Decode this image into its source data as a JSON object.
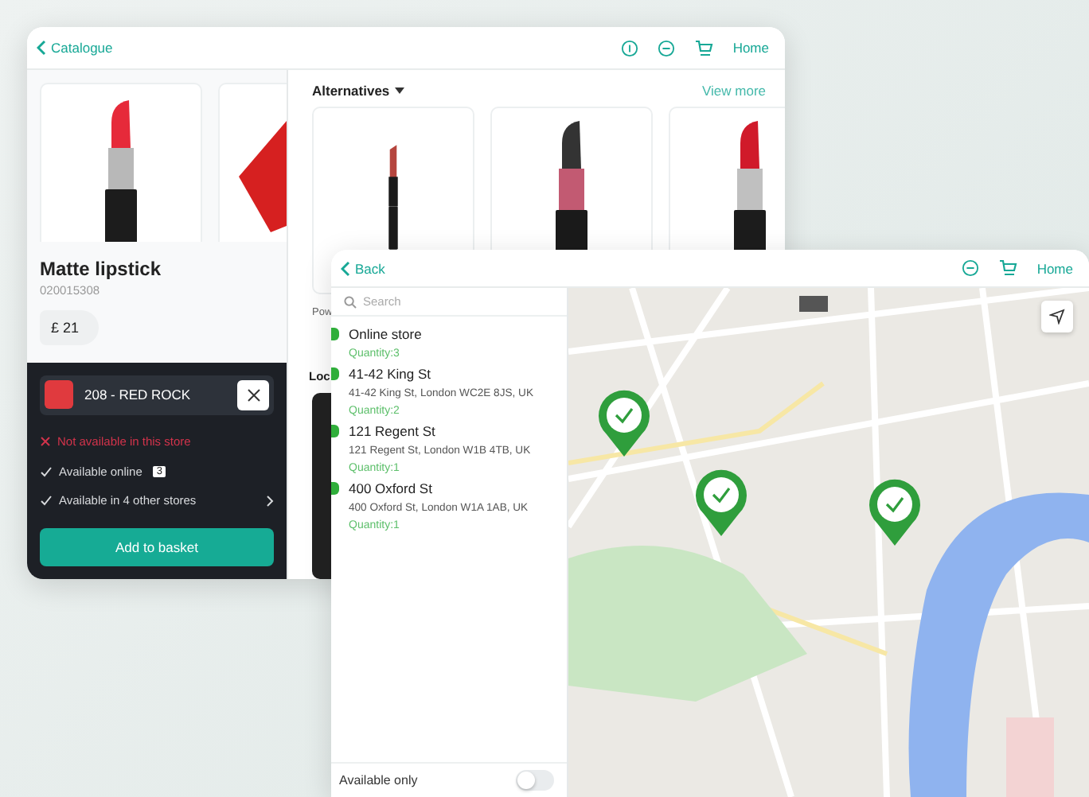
{
  "catalogue_window": {
    "back_label": "Catalogue",
    "home_label": "Home",
    "product": {
      "name": "Matte lipstick",
      "code": "020015308",
      "price": "£ 21"
    },
    "variant": {
      "label": "208 - RED ROCK"
    },
    "availability": [
      {
        "kind": "unavailable",
        "text": "Not available in this store",
        "expandable": false
      },
      {
        "kind": "available",
        "text": "Available online",
        "badge": "3",
        "expandable": false
      },
      {
        "kind": "available",
        "text": "Available in 4 other stores",
        "expandable": true
      }
    ],
    "add_button": "Add to basket",
    "alternatives": {
      "title": "Alternatives",
      "view_more": "View more",
      "caption": "Pow",
      "next_heading": "Loc"
    }
  },
  "store_window": {
    "back_label": "Back",
    "home_label": "Home",
    "search": {
      "placeholder": "Search"
    },
    "stores": [
      {
        "name": "Online store",
        "quantity": "Quantity:3"
      },
      {
        "name": "41-42 King St",
        "address": "41-42 King St, London WC2E 8JS, UK",
        "quantity": "Quantity:2"
      },
      {
        "name": "121 Regent St",
        "address": "121 Regent St, London W1B 4TB, UK",
        "quantity": "Quantity:1"
      },
      {
        "name": "400 Oxford St",
        "address": "400 Oxford St, London W1A 1AB, UK",
        "quantity": "Quantity:1"
      }
    ],
    "filter": {
      "label": "Available only",
      "on": false
    }
  }
}
